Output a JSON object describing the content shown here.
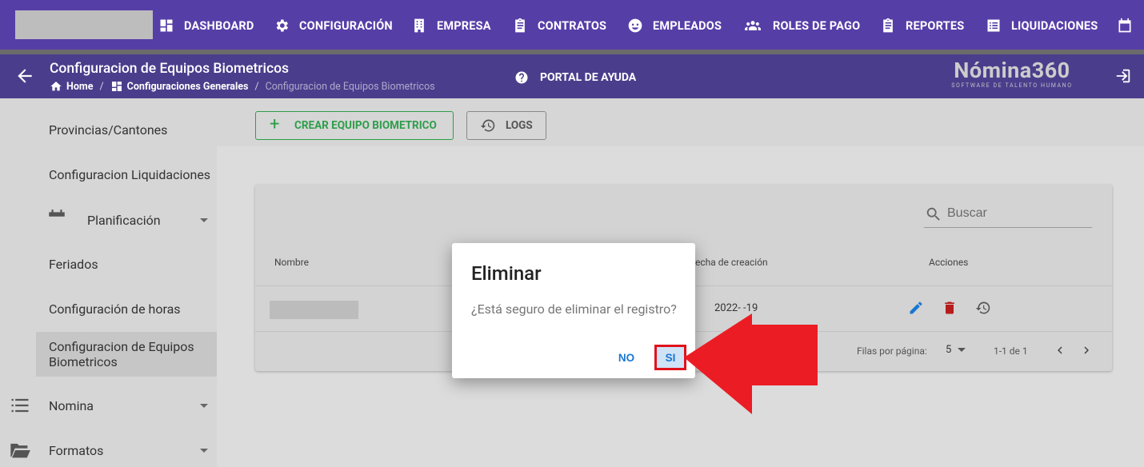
{
  "topnav": {
    "items": [
      {
        "label": "DASHBOARD",
        "icon": "dashboard-icon"
      },
      {
        "label": "CONFIGURACIÓN",
        "icon": "gear-icon"
      },
      {
        "label": "EMPRESA",
        "icon": "building-icon"
      },
      {
        "label": "CONTRATOS",
        "icon": "clipboard-icon"
      },
      {
        "label": "EMPLEADOS",
        "icon": "face-icon"
      },
      {
        "label": "ROLES DE PAGO",
        "icon": "people-icon"
      },
      {
        "label": "REPORTES",
        "icon": "report-icon"
      },
      {
        "label": "LIQUIDACIONES",
        "icon": "list-icon"
      },
      {
        "label": "",
        "icon": "calendar-icon"
      }
    ]
  },
  "header": {
    "title": "Configuracion de Equipos Biometricos",
    "breadcrumb": {
      "home": "Home",
      "section": "Configuraciones Generales",
      "current": "Configuracion de Equipos Biometricos"
    },
    "help_label": "PORTAL DE AYUDA",
    "brand_name": "Nómina360",
    "brand_tagline": "SOFTWARE DE TALENTO HUMANO"
  },
  "sidebar": {
    "items": [
      {
        "label": "Provincias/Cantones"
      },
      {
        "label": "Configuracion Liquidaciones"
      },
      {
        "label": "Planificación",
        "icon": "calendar-icon"
      },
      {
        "label": "Feriados"
      },
      {
        "label": "Configuración de horas"
      },
      {
        "label": "Configuracion de Equipos Biometricos"
      },
      {
        "label": "Nomina",
        "icon": "list-icon"
      },
      {
        "label": "Formatos",
        "icon": "folder-icon"
      }
    ]
  },
  "toolbar": {
    "create_label": "CREAR EQUIPO BIOMETRICO",
    "logs_label": "LOGS"
  },
  "table": {
    "search_placeholder": "Buscar",
    "columns": [
      "Nombre",
      "echa de creación",
      "Acciones"
    ],
    "rows": [
      {
        "name": "",
        "created": "2022-  -19"
      }
    ],
    "rows_per_page_label": "Filas por página:",
    "rows_per_page": "5",
    "range": "1-1 de 1"
  },
  "dialog": {
    "title": "Eliminar",
    "message": "¿Está seguro de eliminar el registro?",
    "no_label": "NO",
    "yes_label": "SI"
  },
  "colors": {
    "nav_bg": "#563ea7",
    "subheader_bg": "#4a3e8c",
    "create_green": "#2e9e4a",
    "action_blue": "#1976d2",
    "delete_red": "#b71c1c",
    "highlight_red": "#e0121c"
  }
}
